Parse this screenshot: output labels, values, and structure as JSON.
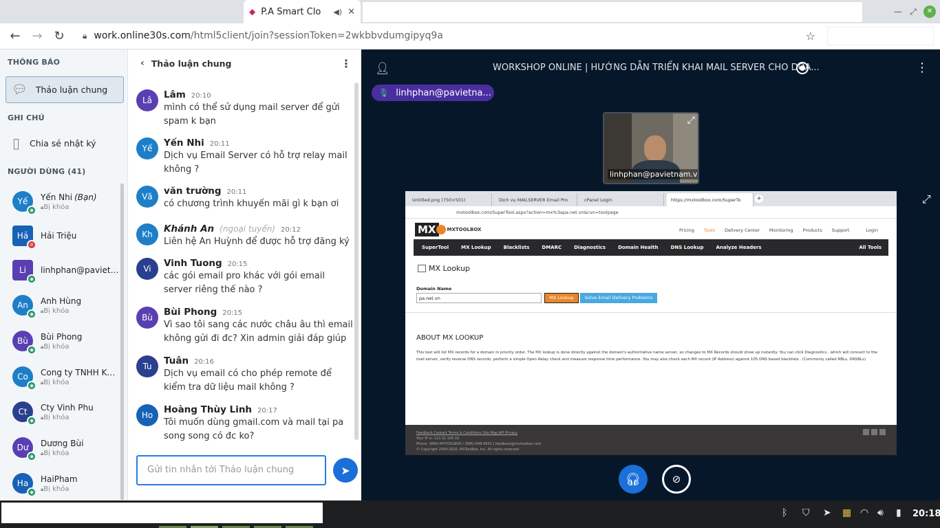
{
  "browser": {
    "tab_title": "P.A Smart Clo",
    "url_host": "work.online30s.com",
    "url_path": "/html5client/join?sessionToken=2wkbbvdumgipyq9a"
  },
  "leftnav": {
    "notifications_heading": "THÔNG BÁO",
    "public_chat_label": "Thảo luận chung",
    "notes_heading": "GHI CHÚ",
    "shared_notes_label": "Chia sẻ nhật ký",
    "users_heading": "NGƯỜI DÙNG (41)",
    "users": [
      {
        "initials": "Yế",
        "name": "Yến Nhi",
        "you": "(Bạn)",
        "status": "Bị khóa",
        "color": "#1e7fc8"
      },
      {
        "initials": "Hả",
        "name": "Hải Triệu",
        "status": "",
        "color": "#1662b6"
      },
      {
        "initials": "Li",
        "name": "linhphan@pavietna...",
        "status": "",
        "color": "#5a3fb3"
      },
      {
        "initials": "An",
        "name": "Anh Hùng",
        "status": "Bị khóa",
        "color": "#1e7fc8"
      },
      {
        "initials": "Bù",
        "name": "Bùi Phong",
        "status": "Bị khóa",
        "color": "#5a3fb3"
      },
      {
        "initials": "Co",
        "name": "Cong ty TNHH Khoi ...",
        "status": "Bị khóa",
        "color": "#1e7fc8"
      },
      {
        "initials": "Ct",
        "name": "Cty Vinh Phu",
        "status": "Bị khóa",
        "color": "#2a3f8f"
      },
      {
        "initials": "Dư",
        "name": "Dương Bùi",
        "status": "Bị khóa",
        "color": "#5a3fb3"
      },
      {
        "initials": "Ha",
        "name": "HaiPham",
        "status": "Bị khóa",
        "color": "#1662b6"
      }
    ]
  },
  "chat": {
    "title": "Thảo luận chung",
    "input_placeholder": "Gửi tin nhắn tới Thảo luận chung",
    "messages": [
      {
        "initials": "Lâ",
        "name": "Lâm",
        "time": "20:10",
        "text": "mình có thể sử dụng mail server để gửi spam k bạn",
        "color": "#5a3fb3"
      },
      {
        "initials": "Yế",
        "name": "Yến Nhi",
        "time": "20:11",
        "text": "Dịch vụ Email Server có hỗ trợ relay mail không ?",
        "color": "#1e7fc8"
      },
      {
        "initials": "Vă",
        "name": "văn trường",
        "time": "20:11",
        "text": "có chương trình khuyến mãi gì k bạn ơi",
        "color": "#1e7fc8"
      },
      {
        "initials": "Kh",
        "name": "Khánh An",
        "offline": "(ngoại tuyến)",
        "time": "20:12",
        "text": "Liên hệ An Huỳnh để được hỗ trợ đăng ký",
        "color": "#1e7fc8"
      },
      {
        "initials": "Vi",
        "name": "Vinh Tuong",
        "time": "20:15",
        "text": "các gói email pro khác với gói email server riêng thế nào ?",
        "color": "#2a3f8f"
      },
      {
        "initials": "Bù",
        "name": "Bùi Phong",
        "time": "20:15",
        "text": "Vì sao tôi sang các nước châu âu thì email không gửi đi đc? Xin admin giải đáp giúp",
        "color": "#5a3fb3"
      },
      {
        "initials": "Tu",
        "name": "Tuân",
        "time": "20:16",
        "text": "Dịch vụ email có cho phép remote để kiểm tra dữ liệu mail không ?",
        "color": "#2a3f8f"
      },
      {
        "initials": "Ho",
        "name": "Hoàng Thùy Linh",
        "time": "20:17",
        "text": "Tôi muốn dùng gmail.com và mail tại pa song song có đc ko?",
        "color": "#1662b6"
      }
    ]
  },
  "stage": {
    "meeting_title": "WORKSHOP ONLINE | HƯỚNG DẪN TRIỂN KHAI MAIL SERVER CHO DOA...",
    "talking_indicator": "linhphan@pavietna...",
    "webcam_label": "linhphan@pavietnam.vn",
    "slide": {
      "tabs": [
        "Untitled.png (750×501)",
        "Dịch vụ MAILSERVER Email Pro",
        "cPanel Login",
        "https://mxtoolbox.com/SuperTo"
      ],
      "url": "mxtoolbox.com/SuperTool.aspx?action=mx%3apa.net.vn&run=toolpage",
      "logo": "MXTOOLBOX",
      "top_links": [
        "Pricing",
        "Tools",
        "Delivery Center",
        "Monitoring",
        "Products",
        "Support",
        "Login"
      ],
      "nav": [
        "SuperTool",
        "MX Lookup",
        "Blacklists",
        "DMARC",
        "Diagnostics",
        "Domain Health",
        "DNS Lookup",
        "Analyze Headers",
        "All Tools"
      ],
      "page_title": "MX Lookup",
      "domain_label": "Domain Name",
      "domain_value": "pa.net.vn",
      "lookup_button": "MX Lookup",
      "solve_button": "Solve Email Delivery Problems",
      "about_heading": "ABOUT MX LOOKUP",
      "about_text": "This test will list MX records for a domain in priority order. The MX lookup is done directly against the domain's authoritative name server, so changes to MX Records should show up instantly. You can click Diagnostics , which will connect to the mail server, verify reverse DNS records, perform a simple Open Relay check and measure response time performance. You may also check each MX record (IP Address) against 105 DNS based blacklists . (Commonly called RBLs, DNSBLs)",
      "footer_links": "Feedback   Contact   Terms & Conditions   Site Map   API   Privacy",
      "footer_ip": "Your IP is: 113.31.105.16",
      "footer_phone": "Phone: (866)-MXTOOLBOX / (866)-698-6652  |  feedback@mxtoolbox.com",
      "footer_copy": "© Copyright 2004-2020, MXToolBox, Inc, All rights reserved"
    }
  },
  "taskbar": {
    "clock": "20:18"
  }
}
